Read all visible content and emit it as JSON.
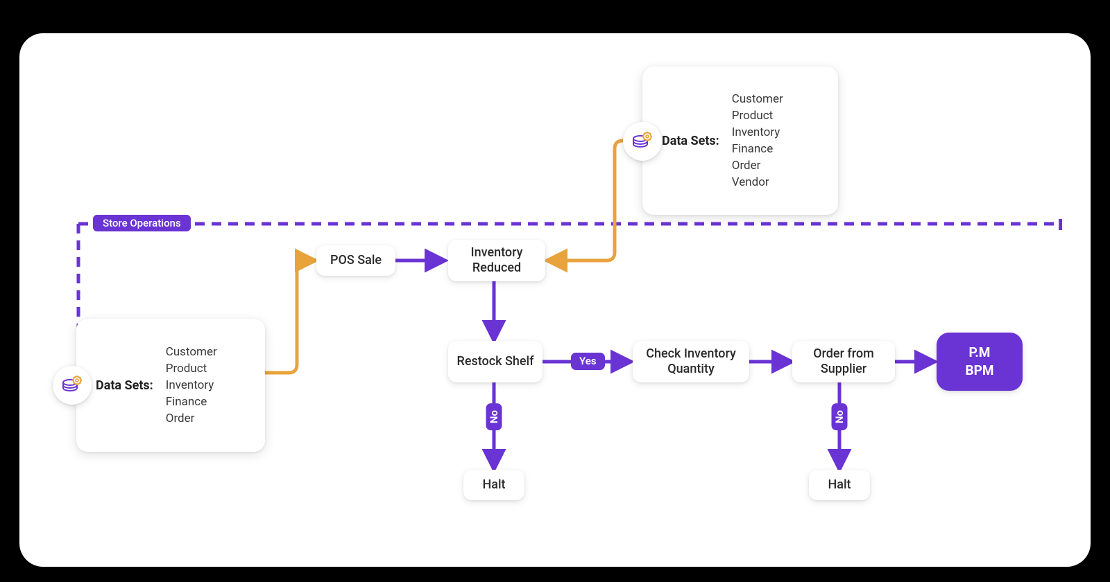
{
  "colors": {
    "purple": "#6A33D4",
    "orange": "#E8A33D"
  },
  "swimlane": {
    "label": "Store Operations"
  },
  "datasets": {
    "left": {
      "title": "Data Sets:",
      "items": [
        "Customer",
        "Product",
        "Inventory",
        "Finance",
        "Order"
      ]
    },
    "right": {
      "title": "Data Sets:",
      "items": [
        "Customer",
        "Product",
        "Inventory",
        "Finance",
        "Order",
        "Vendor"
      ]
    }
  },
  "nodes": {
    "pos_sale": "POS Sale",
    "inventory_reduced": "Inventory Reduced",
    "restock_shelf": "Restock Shelf",
    "check_inventory": "Check Inventory Quantity",
    "order_supplier": "Order from Supplier",
    "halt_left": "Halt",
    "halt_right": "Halt",
    "pm_bpm_line1": "P.M",
    "pm_bpm_line2": "BPM"
  },
  "labels": {
    "yes": "Yes",
    "no_left": "No",
    "no_right": "No"
  },
  "icons": {
    "dataset_left": "database-gear-icon",
    "dataset_right": "database-gear-icon"
  }
}
